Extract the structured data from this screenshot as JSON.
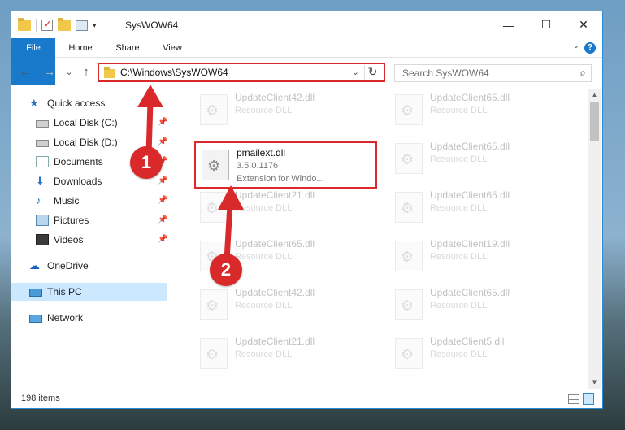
{
  "window": {
    "title": "SysWOW64",
    "controls": {
      "minimize": "—",
      "maximize": "☐",
      "close": "✕"
    }
  },
  "ribbon": {
    "tabs": [
      "File",
      "Home",
      "Share",
      "View"
    ],
    "help": "?"
  },
  "navigation": {
    "back": "←",
    "forward": "→",
    "recent": "⌄",
    "up": "↑"
  },
  "address": {
    "path": "C:\\Windows\\SysWOW64",
    "refresh": "↻",
    "dropdown": "⌄"
  },
  "search": {
    "placeholder": "Search SysWOW64",
    "icon": "⌕"
  },
  "sidebar": {
    "items": [
      {
        "label": "Quick access",
        "icon": "star-icon",
        "pinned": false
      },
      {
        "label": "Local Disk (C:)",
        "icon": "disk-icon",
        "pinned": true
      },
      {
        "label": "Local Disk (D:)",
        "icon": "disk-icon",
        "pinned": true
      },
      {
        "label": "Documents",
        "icon": "documents-icon",
        "pinned": true
      },
      {
        "label": "Downloads",
        "icon": "downloads-icon",
        "pinned": true
      },
      {
        "label": "Music",
        "icon": "music-icon",
        "pinned": true
      },
      {
        "label": "Pictures",
        "icon": "pictures-icon",
        "pinned": true
      },
      {
        "label": "Videos",
        "icon": "videos-icon",
        "pinned": true
      },
      {
        "label": "OneDrive",
        "icon": "cloud-icon",
        "pinned": false
      },
      {
        "label": "This PC",
        "icon": "computer-icon",
        "pinned": false,
        "selected": true
      },
      {
        "label": "Network",
        "icon": "network-icon",
        "pinned": false
      }
    ]
  },
  "files": [
    {
      "name": "UpdateClient42.dll",
      "desc": "Resource DLL"
    },
    {
      "name": "UpdateClient65.dll",
      "desc": "Resource DLL"
    },
    {
      "name": "pmailext.dll",
      "version": "3.5.0.1176",
      "desc": "Extension for Windo...",
      "highlighted": true
    },
    {
      "name": "UpdateClient65.dll",
      "desc": "Resource DLL"
    },
    {
      "name": "UpdateClient21.dll",
      "desc": "Resource DLL"
    },
    {
      "name": "UpdateClient65.dll",
      "desc": "Resource DLL"
    },
    {
      "name": "UpdateClient65.dll",
      "desc": "Resource DLL"
    },
    {
      "name": "UpdateClient19.dll",
      "desc": "Resource DLL"
    },
    {
      "name": "UpdateClient42.dll",
      "desc": "Resource DLL"
    },
    {
      "name": "UpdateClient65.dll",
      "desc": "Resource DLL"
    },
    {
      "name": "UpdateClient21.dll",
      "desc": "Resource DLL"
    },
    {
      "name": "UpdateClient5.dll",
      "desc": "Resource DLL"
    }
  ],
  "status": {
    "item_count": "198 items"
  },
  "annotations": {
    "step1": "1",
    "step2": "2",
    "color": "#d9292a"
  },
  "colors": {
    "accent": "#1979ca",
    "highlight": "#d9292a",
    "selected": "#cce8ff"
  }
}
